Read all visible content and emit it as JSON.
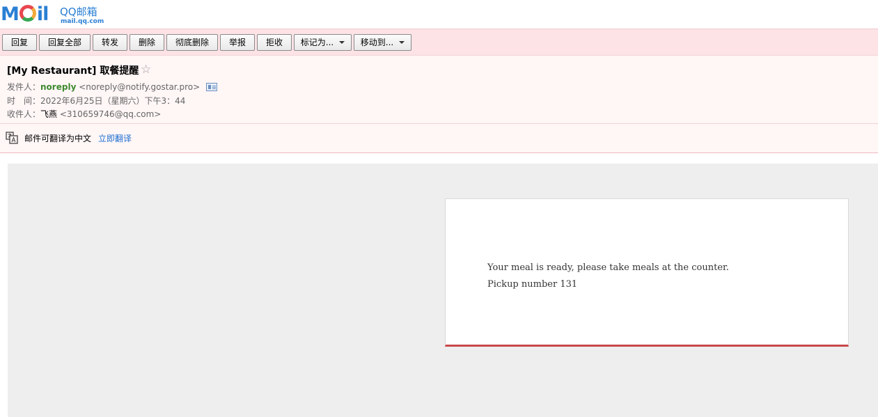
{
  "logo": {
    "brand": "M",
    "brand_tail": "il",
    "product": "QQ邮箱",
    "domain": "mail.qq.com"
  },
  "toolbar": {
    "buttons": [
      {
        "label": "回复"
      },
      {
        "label": "回复全部"
      },
      {
        "label": "转发"
      },
      {
        "label": "删除"
      },
      {
        "label": "彻底删除"
      },
      {
        "label": "举报"
      },
      {
        "label": "拒收"
      },
      {
        "label": "标记为..."
      },
      {
        "label": "移动到..."
      }
    ]
  },
  "email": {
    "subject": "[My Restaurant] 取餐提醒",
    "star": "☆",
    "from_label": "发件人：",
    "from_name": "noreply",
    "from_addr": "<noreply@notify.gostar.pro>",
    "time_label": "时　间：",
    "time_value": "2022年6月25日（星期六）下午3：44",
    "to_label": "收件人：",
    "to_name": "飞燕",
    "to_addr": "<310659746@qq.com>"
  },
  "translate": {
    "notice": "邮件可翻译为中文",
    "link": "立即翻译"
  },
  "body": {
    "line1": "Your meal is ready, please take meals at the counter.",
    "line2": "Pickup number 131"
  },
  "colors": {
    "toolbar_bg": "#fde3e6",
    "header_bg": "#fff6f6",
    "sender_green": "#3d8a2f",
    "link_blue": "#1e6fd1",
    "card_accent": "#c9484a"
  }
}
